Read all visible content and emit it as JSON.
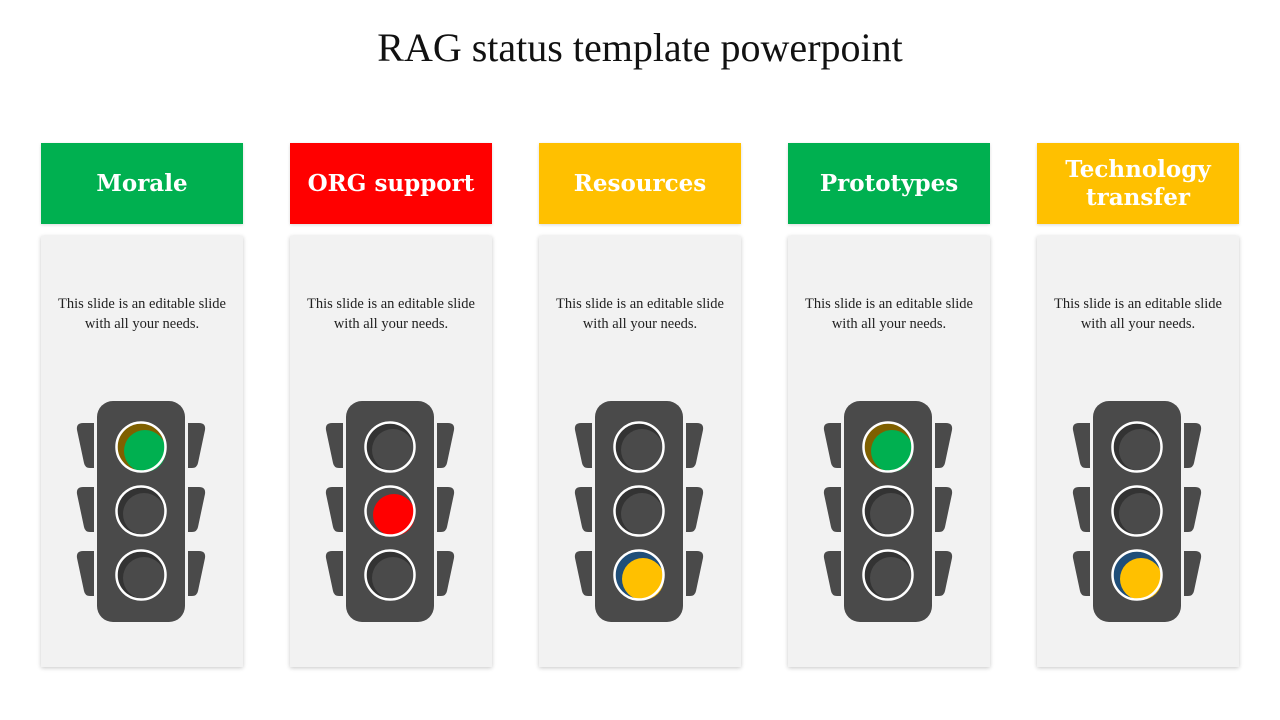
{
  "slide": {
    "title": "RAG status template powerpoint"
  },
  "colors": {
    "green": "#00b050",
    "red": "#ff0000",
    "amber": "#ffc000",
    "housing": "#4a4a4a",
    "panel": "#f2f2f2",
    "green_shade": "#7f6000",
    "red_shade": "#4a4a4a",
    "amber_shade": "#1f4e79"
  },
  "cards": [
    {
      "header": "Morale",
      "header_color": "#00b050",
      "text": "This slide is an editable slide with all your needs.",
      "status": "green",
      "active_lamp": "top"
    },
    {
      "header": "ORG support",
      "header_color": "#ff0000",
      "text": "This slide is an editable slide with all your needs.",
      "status": "red",
      "active_lamp": "middle"
    },
    {
      "header": "Resources",
      "header_color": "#ffc000",
      "text": "This slide is an editable slide with all your needs.",
      "status": "amber",
      "active_lamp": "bottom"
    },
    {
      "header": "Prototypes",
      "header_color": "#00b050",
      "text": "This slide is an editable slide with all your needs.",
      "status": "green",
      "active_lamp": "top"
    },
    {
      "header": "Technology transfer",
      "header_color": "#ffc000",
      "text": "This slide is an editable slide with all your needs.",
      "status": "amber",
      "active_lamp": "bottom"
    }
  ]
}
